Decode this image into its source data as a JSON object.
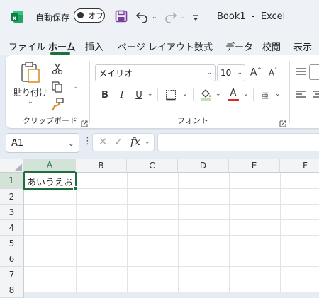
{
  "app": {
    "autosave_label": "自動保存",
    "autosave_state": "オフ",
    "title": "Book1  -  Excel",
    "accent_color": "#1e6e3f"
  },
  "tabs": [
    "ファイル",
    "ホーム",
    "挿入",
    "ページ レイアウト",
    "数式",
    "データ",
    "校閲",
    "表示"
  ],
  "active_tab": "ホーム",
  "clipboard": {
    "paste_label": "貼り付け",
    "group_label": "クリップボード"
  },
  "font": {
    "name": "メイリオ",
    "size": "10",
    "group_label": "フォント",
    "bold": "B",
    "italic": "I",
    "underline": "U",
    "font_color_letter": "A",
    "font_color": "#e0242b",
    "phonetic_glyph": "亜"
  },
  "formula_bar": {
    "name_box": "A1",
    "fx": "fx",
    "value": ""
  },
  "sheet": {
    "columns": [
      "A",
      "B",
      "C",
      "D",
      "E",
      "F"
    ],
    "rows": [
      "1",
      "2",
      "3",
      "4",
      "5",
      "6",
      "7",
      "8"
    ],
    "selected_cell": "A1",
    "cells": {
      "A1": "あいうえお"
    }
  }
}
